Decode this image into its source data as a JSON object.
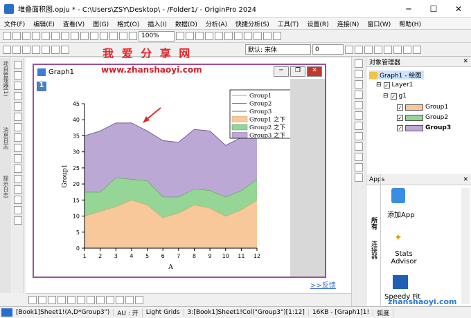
{
  "window": {
    "title": "堆叠面积图.opju * - C:\\Users\\ZSY\\Desktop\\ - /Folder1/ - OriginPro 2024",
    "min": "─",
    "max": "☐",
    "close": "✕"
  },
  "menu": [
    "文件(F)",
    "编辑(E)",
    "查看(V)",
    "图(G)",
    "格式(O)",
    "插入(I)",
    "数据(D)",
    "分析(A)",
    "快捷分析(S)",
    "工具(T)",
    "设置(R)",
    "连接(N)",
    "窗口(W)",
    "帮助(H)"
  ],
  "toolbar": {
    "zoom": "100%",
    "font": "默认: 宋体",
    "size": "0"
  },
  "watermark": {
    "top": "我 爱 分 享 网",
    "url": "www.zhanshaoyi.com",
    "bottom": "zhanshaoyi.com"
  },
  "left_side": {
    "a": "项目管理器(1)",
    "b": "消息日志",
    "c": "提示日志"
  },
  "graph_window": {
    "title": "Graph1",
    "layer": "1",
    "feedback": ">>反馈"
  },
  "object_manager": {
    "title": "对象管理器",
    "root": "Graph1 - 绘图",
    "layer": "Layer1",
    "group": "g1",
    "items": [
      {
        "label": "Group1",
        "color": "#f8c89a"
      },
      {
        "label": "Group2",
        "color": "#95d595"
      },
      {
        "label": "Group3",
        "color": "#bca8d4"
      }
    ]
  },
  "apps": {
    "title": "Apps",
    "tabs": [
      "所有",
      "连接器"
    ],
    "items": [
      "添加App",
      "Stats Advisor",
      "Speedy Fit"
    ]
  },
  "status": [
    "[Book1]Sheet1!(A,D*Group3\")",
    "AU : 开",
    "Light Grids",
    "3:[Book1]Sheet1!Col(\"Group3\")[1:12]",
    "16KB - [Graph1]1!",
    "弧度"
  ],
  "chart_data": {
    "type": "area",
    "stacked": true,
    "x": [
      1,
      2,
      3,
      4,
      5,
      6,
      7,
      8,
      9,
      10,
      11,
      12
    ],
    "xlabel": "A",
    "ylabel": "Group1",
    "xlim": [
      1,
      12
    ],
    "ylim": [
      0,
      45
    ],
    "yticks": [
      0,
      5,
      10,
      15,
      20,
      25,
      30,
      35,
      40,
      45
    ],
    "series": [
      {
        "name": "Group1",
        "color": "#f8c89a",
        "line": "#c89a6a",
        "values": [
          10,
          11.5,
          13,
          15,
          13.5,
          9.5,
          11,
          13.5,
          12.5,
          10,
          12,
          15
        ]
      },
      {
        "name": "Group2",
        "color": "#95d595",
        "line": "#4d9b4d",
        "values": [
          7.5,
          6,
          9,
          6.5,
          7.5,
          6.5,
          5,
          5,
          5.5,
          6,
          6,
          6.5
        ]
      },
      {
        "name": "Group3",
        "color": "#bca8d4",
        "line": "#7a5ca0",
        "values": [
          17.5,
          19,
          17,
          17.5,
          15.5,
          17.5,
          17,
          18.5,
          18.5,
          16,
          16.5,
          17
        ]
      }
    ],
    "legend": {
      "position": "top-right",
      "entries": [
        "Group1",
        "Group2",
        "Group3",
        "Group1 之下",
        "Group2 之下",
        "Group3 之下"
      ]
    }
  }
}
